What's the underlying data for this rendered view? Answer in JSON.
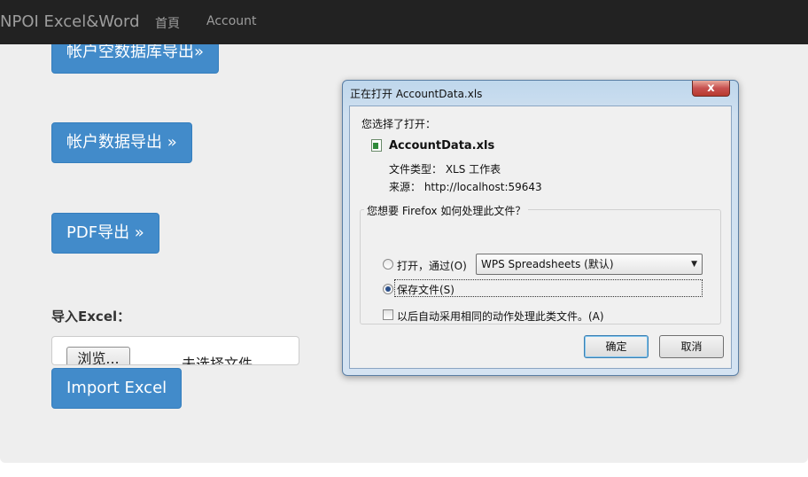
{
  "navbar": {
    "brand": "NPOI Excel&Word",
    "links": [
      "首頁",
      "Account"
    ]
  },
  "main": {
    "buttons": [
      "帐户空数据库导出»",
      "帐户数据导出 »",
      "PDF导出 »",
      "Import Excel"
    ],
    "import_label": "导入Excel：",
    "file_input": {
      "browse_label": "浏览...",
      "no_file_text": "未选择文件。"
    }
  },
  "dialog": {
    "title": "正在打开 AccountData.xls",
    "close_glyph": "x",
    "chosen_label": "您选择了打开：",
    "file_name": "AccountData.xls",
    "file_type": "文件类型：  XLS 工作表",
    "source": "来源：  http://localhost:59643",
    "question": "您想要 Firefox 如何处理此文件？",
    "open_with_label": "打开，通过(O)",
    "open_with_app": "WPS Spreadsheets (默认)",
    "save_file_label": "保存文件(S)",
    "auto_label": "以后自动采用相同的动作处理此类文件。(A)",
    "ok_label": "确定",
    "cancel_label": "取消",
    "selected_option": "save_file"
  }
}
